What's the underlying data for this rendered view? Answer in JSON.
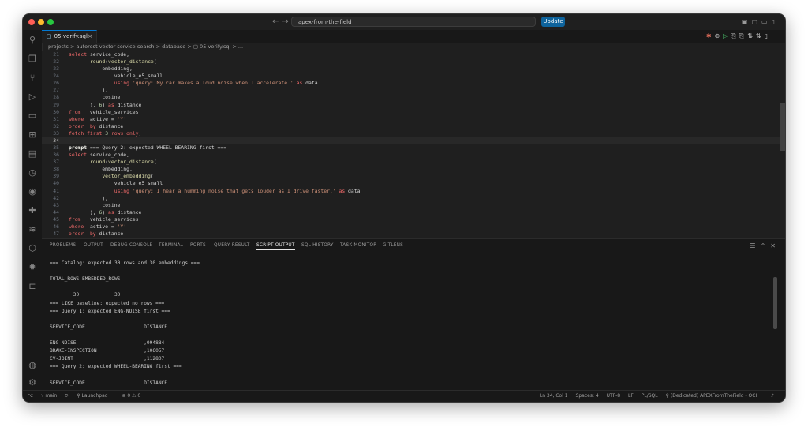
{
  "titlebar": {
    "search": "apex-from-the-field",
    "update": "Update"
  },
  "tab": {
    "name": "05-verify.sql",
    "close": "×"
  },
  "breadcrumb": "projects > autorest-vector-service-search > database > ▢ 05-verify.sql > ...",
  "editor_lines": [
    {
      "n": "21",
      "html": "<span class='kw'>select</span> service_code,"
    },
    {
      "n": "22",
      "html": "       <span class='fn'>round</span>(<span class='fn'>vector_distance</span>("
    },
    {
      "n": "23",
      "html": "           embedding,"
    },
    {
      "n": "24",
      "html": "               vehicle_e5_small"
    },
    {
      "n": "26",
      "html": "               <span class='kw'>using</span> <span class='str'>'query: My car makes a loud noise when I accelerate.'</span> <span class='kw'>as</span> data"
    },
    {
      "n": "27",
      "html": "           ),"
    },
    {
      "n": "28",
      "html": "           cosine"
    },
    {
      "n": "29",
      "html": "       ), <span class='num'>6</span>) <span class='kw'>as</span> distance"
    },
    {
      "n": "30",
      "html": "<span class='kw'>from</span>   vehicle_services"
    },
    {
      "n": "31",
      "html": "<span class='kw'>where</span>  active = <span class='str'>'Y'</span>"
    },
    {
      "n": "32",
      "html": "<span class='kw'>order</span>  <span class='kw'>by</span> distance"
    },
    {
      "n": "33",
      "html": "<span class='kw'>fetch first</span> <span class='num'>3</span> <span class='kw'>rows only</span>;"
    },
    {
      "n": "34",
      "html": "",
      "cur": true
    },
    {
      "n": "35",
      "html": "<span class='pr'>prompt</span> === Query 2: expected WHEEL-BEARING first ==="
    },
    {
      "n": "36",
      "html": "<span class='kw'>select</span> service_code,"
    },
    {
      "n": "37",
      "html": "       <span class='fn'>round</span>(<span class='fn'>vector_distance</span>("
    },
    {
      "n": "38",
      "html": "           embedding,"
    },
    {
      "n": "39",
      "html": "           <span class='fn'>vector_embedding</span>("
    },
    {
      "n": "40",
      "html": "               vehicle_e5_small"
    },
    {
      "n": "41",
      "html": "               <span class='kw'>using</span> <span class='str'>'query: I hear a humming noise that gets louder as I drive faster.'</span> <span class='kw'>as</span> data"
    },
    {
      "n": "42",
      "html": "           ),"
    },
    {
      "n": "43",
      "html": "           cosine"
    },
    {
      "n": "44",
      "html": "       ), <span class='num'>6</span>) <span class='kw'>as</span> distance"
    },
    {
      "n": "45",
      "html": "<span class='kw'>from</span>   vehicle_services"
    },
    {
      "n": "46",
      "html": "<span class='kw'>where</span>  active = <span class='str'>'Y'</span>"
    },
    {
      "n": "47",
      "html": "<span class='kw'>order</span>  <span class='kw'>by</span> distance"
    },
    {
      "n": "48",
      "html": "<span class='kw'>fetch first</span> <span class='num'>3</span> <span class='kw'>rows only</span>;"
    }
  ],
  "panel_tabs": [
    "PROBLEMS",
    "OUTPUT",
    "DEBUG CONSOLE",
    "TERMINAL",
    "PORTS",
    "QUERY RESULT",
    "SCRIPT OUTPUT",
    "SQL HISTORY",
    "TASK MONITOR",
    "GITLENS"
  ],
  "panel_active": "SCRIPT OUTPUT",
  "output_lines": [
    "=== Catalog: expected 30 rows and 30 embeddings ===",
    "",
    "TOTAL_ROWS EMBEDDED_ROWS",
    "---------- -------------",
    "        30            30",
    "=== LIKE baseline: expected no rows ===",
    "=== Query 1: expected ENG-NOISE first ===",
    "",
    "SERVICE_CODE                    DISTANCE",
    "------------------------------ ----------",
    "ENG-NOISE                       ,094884",
    "BRAKE-INSPECTION                ,106057",
    "CV-JOINT                        ,112807",
    "=== Query 2: expected WHEEL-BEARING first ===",
    "",
    "SERVICE_CODE                    DISTANCE"
  ],
  "status": {
    "branch": "main",
    "launchpad": "Launchpad",
    "problems": "⊗ 0 ⚠ 0",
    "cursor": "Ln 34, Col 1",
    "spaces": "Spaces: 4",
    "encoding": "UTF-8",
    "eol": "LF",
    "language": "PL/SQL",
    "connection": "(Dedicated) APEXFromTheField - OCI"
  }
}
